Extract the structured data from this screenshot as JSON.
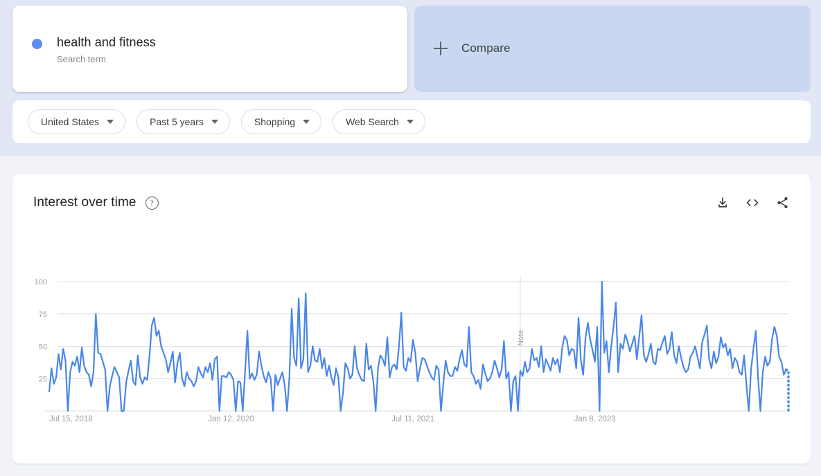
{
  "query_card": {
    "term": "health and fitness",
    "subtitle": "Search term",
    "dot_color": "#5e8df5"
  },
  "compare_card": {
    "label": "Compare",
    "icon": "plus-icon",
    "bg_color": "#c9d8f0"
  },
  "filters": [
    {
      "label": "United States",
      "icon": "chevron-down-icon"
    },
    {
      "label": "Past 5 years",
      "icon": "chevron-down-icon"
    },
    {
      "label": "Shopping",
      "icon": "chevron-down-icon"
    },
    {
      "label": "Web Search",
      "icon": "chevron-down-icon"
    }
  ],
  "chart_panel": {
    "title": "Interest over time",
    "help_icon": "help-icon",
    "help_glyph": "?",
    "actions": [
      {
        "name": "download-icon"
      },
      {
        "name": "embed-icon"
      },
      {
        "name": "share-icon"
      }
    ]
  },
  "chart_data": {
    "type": "line",
    "title": "Interest over time",
    "xlabel": "",
    "ylabel": "",
    "ylim": [
      0,
      100
    ],
    "grid": true,
    "legend": false,
    "line_color": "#4a86e8",
    "x_tick_labels": [
      "Jul 15, 2018",
      "Jan 12, 2020",
      "Jul 11, 2021",
      "Jan 8, 2023"
    ],
    "x_tick_positions": [
      0,
      78,
      156,
      234
    ],
    "y_ticks": [
      25,
      50,
      75,
      100
    ],
    "annotation": {
      "label": "Note",
      "x_index": 202
    },
    "partial_tail": true,
    "series": [
      {
        "name": "health and fitness",
        "values": [
          15,
          33,
          21,
          26,
          44,
          32,
          48,
          39,
          0,
          30,
          38,
          35,
          42,
          30,
          49,
          35,
          30,
          28,
          19,
          30,
          75,
          45,
          44,
          38,
          32,
          0,
          19,
          27,
          34,
          30,
          26,
          0,
          0,
          22,
          31,
          39,
          23,
          20,
          43,
          26,
          21,
          26,
          24,
          42,
          66,
          72,
          58,
          62,
          50,
          45,
          40,
          30,
          37,
          46,
          22,
          37,
          45,
          25,
          19,
          30,
          25,
          23,
          19,
          23,
          34,
          29,
          26,
          34,
          30,
          37,
          24,
          40,
          42,
          0,
          27,
          27,
          26,
          30,
          28,
          24,
          0,
          23,
          22,
          0,
          30,
          62,
          25,
          29,
          24,
          28,
          46,
          35,
          27,
          22,
          30,
          25,
          0,
          28,
          20,
          25,
          30,
          20,
          0,
          26,
          79,
          41,
          35,
          87,
          33,
          40,
          91,
          30,
          35,
          50,
          39,
          38,
          48,
          33,
          41,
          27,
          35,
          26,
          20,
          33,
          26,
          0,
          14,
          37,
          33,
          25,
          28,
          50,
          33,
          28,
          24,
          23,
          52,
          32,
          35,
          23,
          0,
          33,
          43,
          40,
          35,
          57,
          26,
          34,
          36,
          32,
          50,
          76,
          34,
          31,
          41,
          38,
          55,
          45,
          23,
          33,
          41,
          40,
          35,
          30,
          26,
          24,
          35,
          32,
          0,
          21,
          39,
          30,
          27,
          27,
          34,
          31,
          40,
          47,
          36,
          34,
          65,
          30,
          27,
          21,
          24,
          17,
          36,
          29,
          23,
          25,
          30,
          39,
          33,
          26,
          32,
          54,
          25,
          30,
          0,
          23,
          27,
          0,
          31,
          27,
          38,
          30,
          33,
          48,
          39,
          41,
          34,
          50,
          30,
          40,
          36,
          31,
          41,
          36,
          40,
          30,
          49,
          58,
          55,
          43,
          48,
          47,
          33,
          72,
          39,
          28,
          57,
          68,
          55,
          47,
          38,
          65,
          0,
          100,
          45,
          54,
          30,
          50,
          65,
          84,
          30,
          52,
          48,
          59,
          54,
          46,
          52,
          58,
          40,
          57,
          74,
          43,
          38,
          44,
          52,
          38,
          36,
          48,
          47,
          53,
          58,
          44,
          48,
          61,
          43,
          37,
          50,
          41,
          34,
          30,
          32,
          42,
          45,
          50,
          42,
          33,
          53,
          59,
          66,
          40,
          33,
          46,
          37,
          42,
          57,
          49,
          52,
          43,
          48,
          33,
          41,
          38,
          30,
          28,
          43,
          20,
          0,
          33,
          48,
          62,
          25,
          0,
          30,
          42,
          35,
          38,
          56,
          65,
          58,
          42,
          38,
          28,
          32,
          31
        ]
      }
    ]
  }
}
